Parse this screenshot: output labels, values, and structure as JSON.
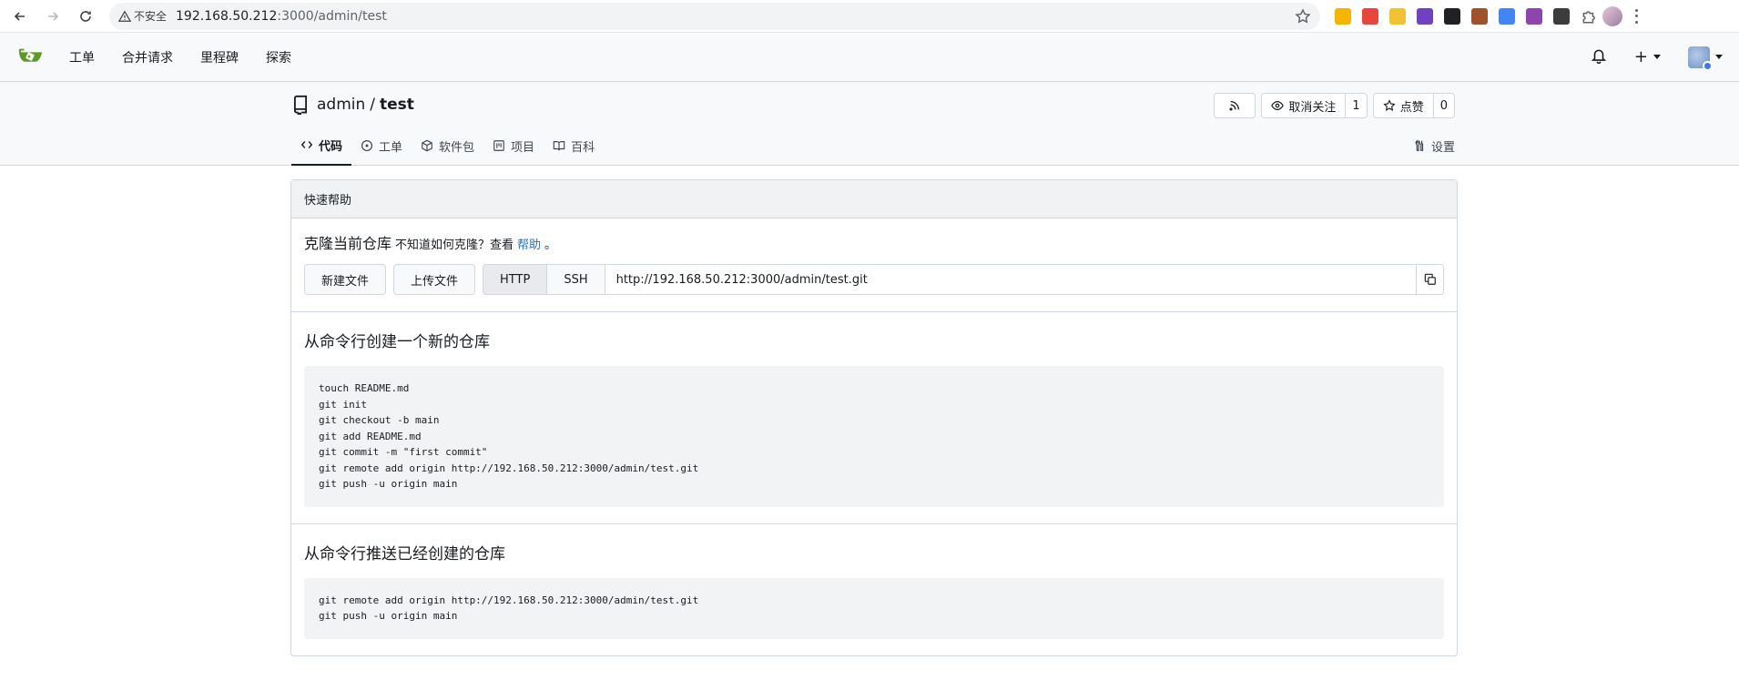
{
  "browser": {
    "insecure_label": "不安全",
    "url_host": "192.168.50.212",
    "url_rest": ":3000/admin/test",
    "extensions": [
      {
        "icon": "ext-yellow-icon",
        "color": "#f4b400"
      },
      {
        "icon": "ext-red-icon",
        "color": "#e8453c"
      },
      {
        "icon": "ext-star-icon",
        "color": "#f1c232"
      },
      {
        "icon": "ext-purple-icon",
        "color": "#6f42c1"
      },
      {
        "icon": "ext-dark-icon",
        "color": "#202124"
      },
      {
        "icon": "ext-fox-icon",
        "color": "#a0522d"
      },
      {
        "icon": "ext-google-icon",
        "color": "#4285f4"
      },
      {
        "icon": "ext-violet-icon",
        "color": "#8e44ad"
      },
      {
        "icon": "ext-notion-icon",
        "color": "#3c3c3c"
      }
    ]
  },
  "navbar": {
    "items": [
      "工单",
      "合并请求",
      "里程碑",
      "探索"
    ],
    "plus": "+"
  },
  "repo": {
    "owner": "admin",
    "separator": "/",
    "name": "test",
    "unwatch_label": "取消关注",
    "watch_count": "1",
    "star_label": "点赞",
    "star_count": "0",
    "tabs": [
      {
        "label": "代码",
        "icon": "code-icon",
        "active": true
      },
      {
        "label": "工单",
        "icon": "issue-icon",
        "active": false
      },
      {
        "label": "软件包",
        "icon": "package-icon",
        "active": false
      },
      {
        "label": "项目",
        "icon": "project-icon",
        "active": false
      },
      {
        "label": "百科",
        "icon": "book-icon",
        "active": false
      }
    ],
    "settings_label": "设置"
  },
  "quickstart": {
    "header": "快速帮助",
    "clone_title": "克隆当前仓库",
    "clone_hint": "不知道如何克隆？查看",
    "help_link": "帮助",
    "period": "。",
    "new_file": "新建文件",
    "upload_file": "上传文件",
    "http": "HTTP",
    "ssh": "SSH",
    "clone_url": "http://192.168.50.212:3000/admin/test.git",
    "new_repo_title": "从命令行创建一个新的仓库",
    "new_repo_cmds": "touch README.md\ngit init\ngit checkout -b main\ngit add README.md\ngit commit -m \"first commit\"\ngit remote add origin http://192.168.50.212:3000/admin/test.git\ngit push -u origin main",
    "push_repo_title": "从命令行推送已经创建的仓库",
    "push_repo_cmds": "git remote add origin http://192.168.50.212:3000/admin/test.git\ngit push -u origin main"
  }
}
